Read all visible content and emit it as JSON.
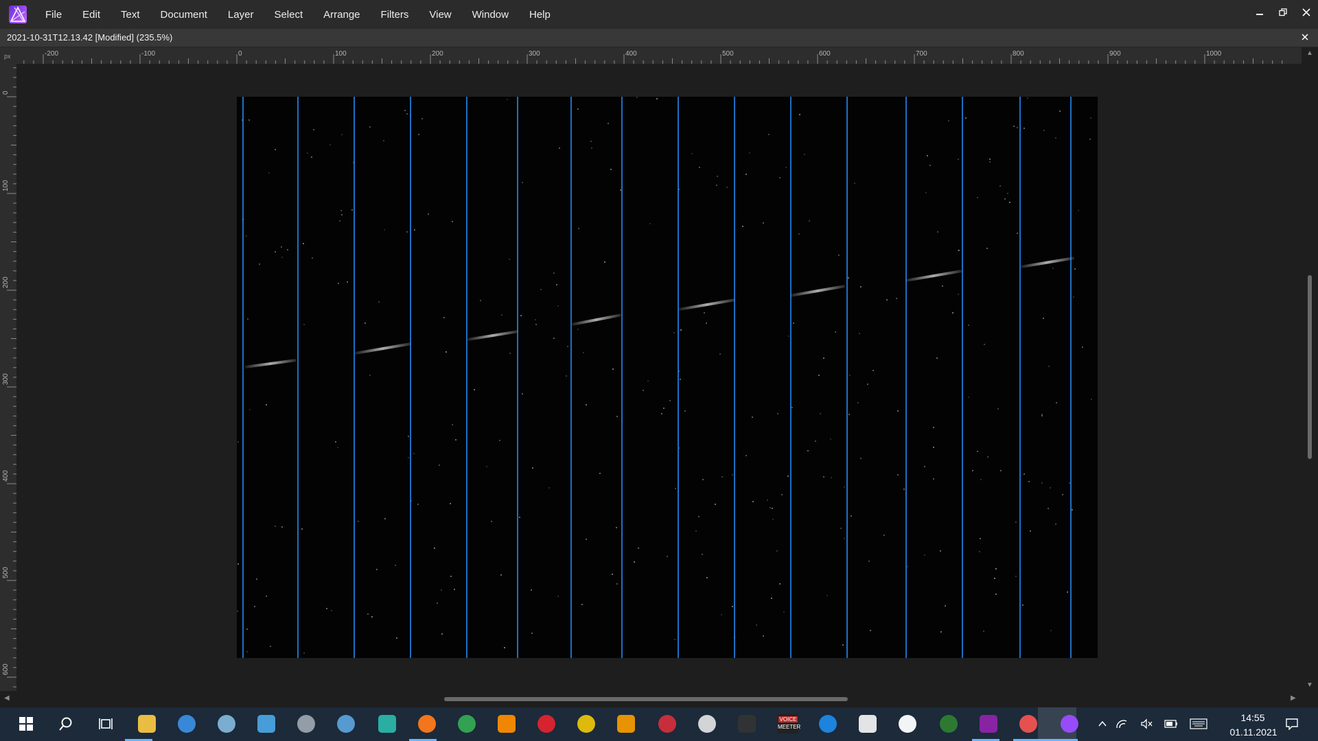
{
  "menubar": {
    "items": [
      {
        "label": "File"
      },
      {
        "label": "Edit"
      },
      {
        "label": "Text"
      },
      {
        "label": "Document"
      },
      {
        "label": "Layer"
      },
      {
        "label": "Select"
      },
      {
        "label": "Arrange"
      },
      {
        "label": "Filters"
      },
      {
        "label": "View"
      },
      {
        "label": "Window"
      },
      {
        "label": "Help"
      }
    ]
  },
  "document": {
    "title": "2021-10-31T12.13.42 [Modified] (235.5%)"
  },
  "ruler": {
    "unit": "px",
    "horizontal_ticks": [
      "-200",
      "-100",
      "0",
      "100",
      "200",
      "300",
      "400",
      "500",
      "600",
      "700",
      "800",
      "900",
      "1000"
    ],
    "vertical_ticks": [
      "0",
      "100",
      "200",
      "300",
      "400",
      "500",
      "600"
    ]
  },
  "taskbar": {
    "apps": [
      "start-icon",
      "search-icon",
      "task-view-icon",
      "file-explorer-icon",
      "store-icon",
      "notepad-icon",
      "remote-desktop-icon",
      "printer-icon",
      "control-panel-icon",
      "edge-icon",
      "firefox-icon",
      "chrome-icon",
      "brave-icon",
      "opera-icon",
      "magnifier-icon",
      "vlc-like-icon",
      "affinity-designer-icon",
      "obs-icon",
      "piano-icon",
      "voicemeeter-icon",
      "teamviewer-icon",
      "calendar-icon",
      "keyboard-app-icon",
      "camera-app-icon",
      "pdf-icon",
      "paint-icon",
      "affinity-photo-icon"
    ],
    "voicemeeter_label": "VOICE\nMEETER",
    "time": "14:55",
    "date": "01.11.2021"
  },
  "colors": {
    "guide": "#1f6fc4",
    "menubar": "#2b2b2b",
    "taskbar": "#1c2a3a"
  }
}
